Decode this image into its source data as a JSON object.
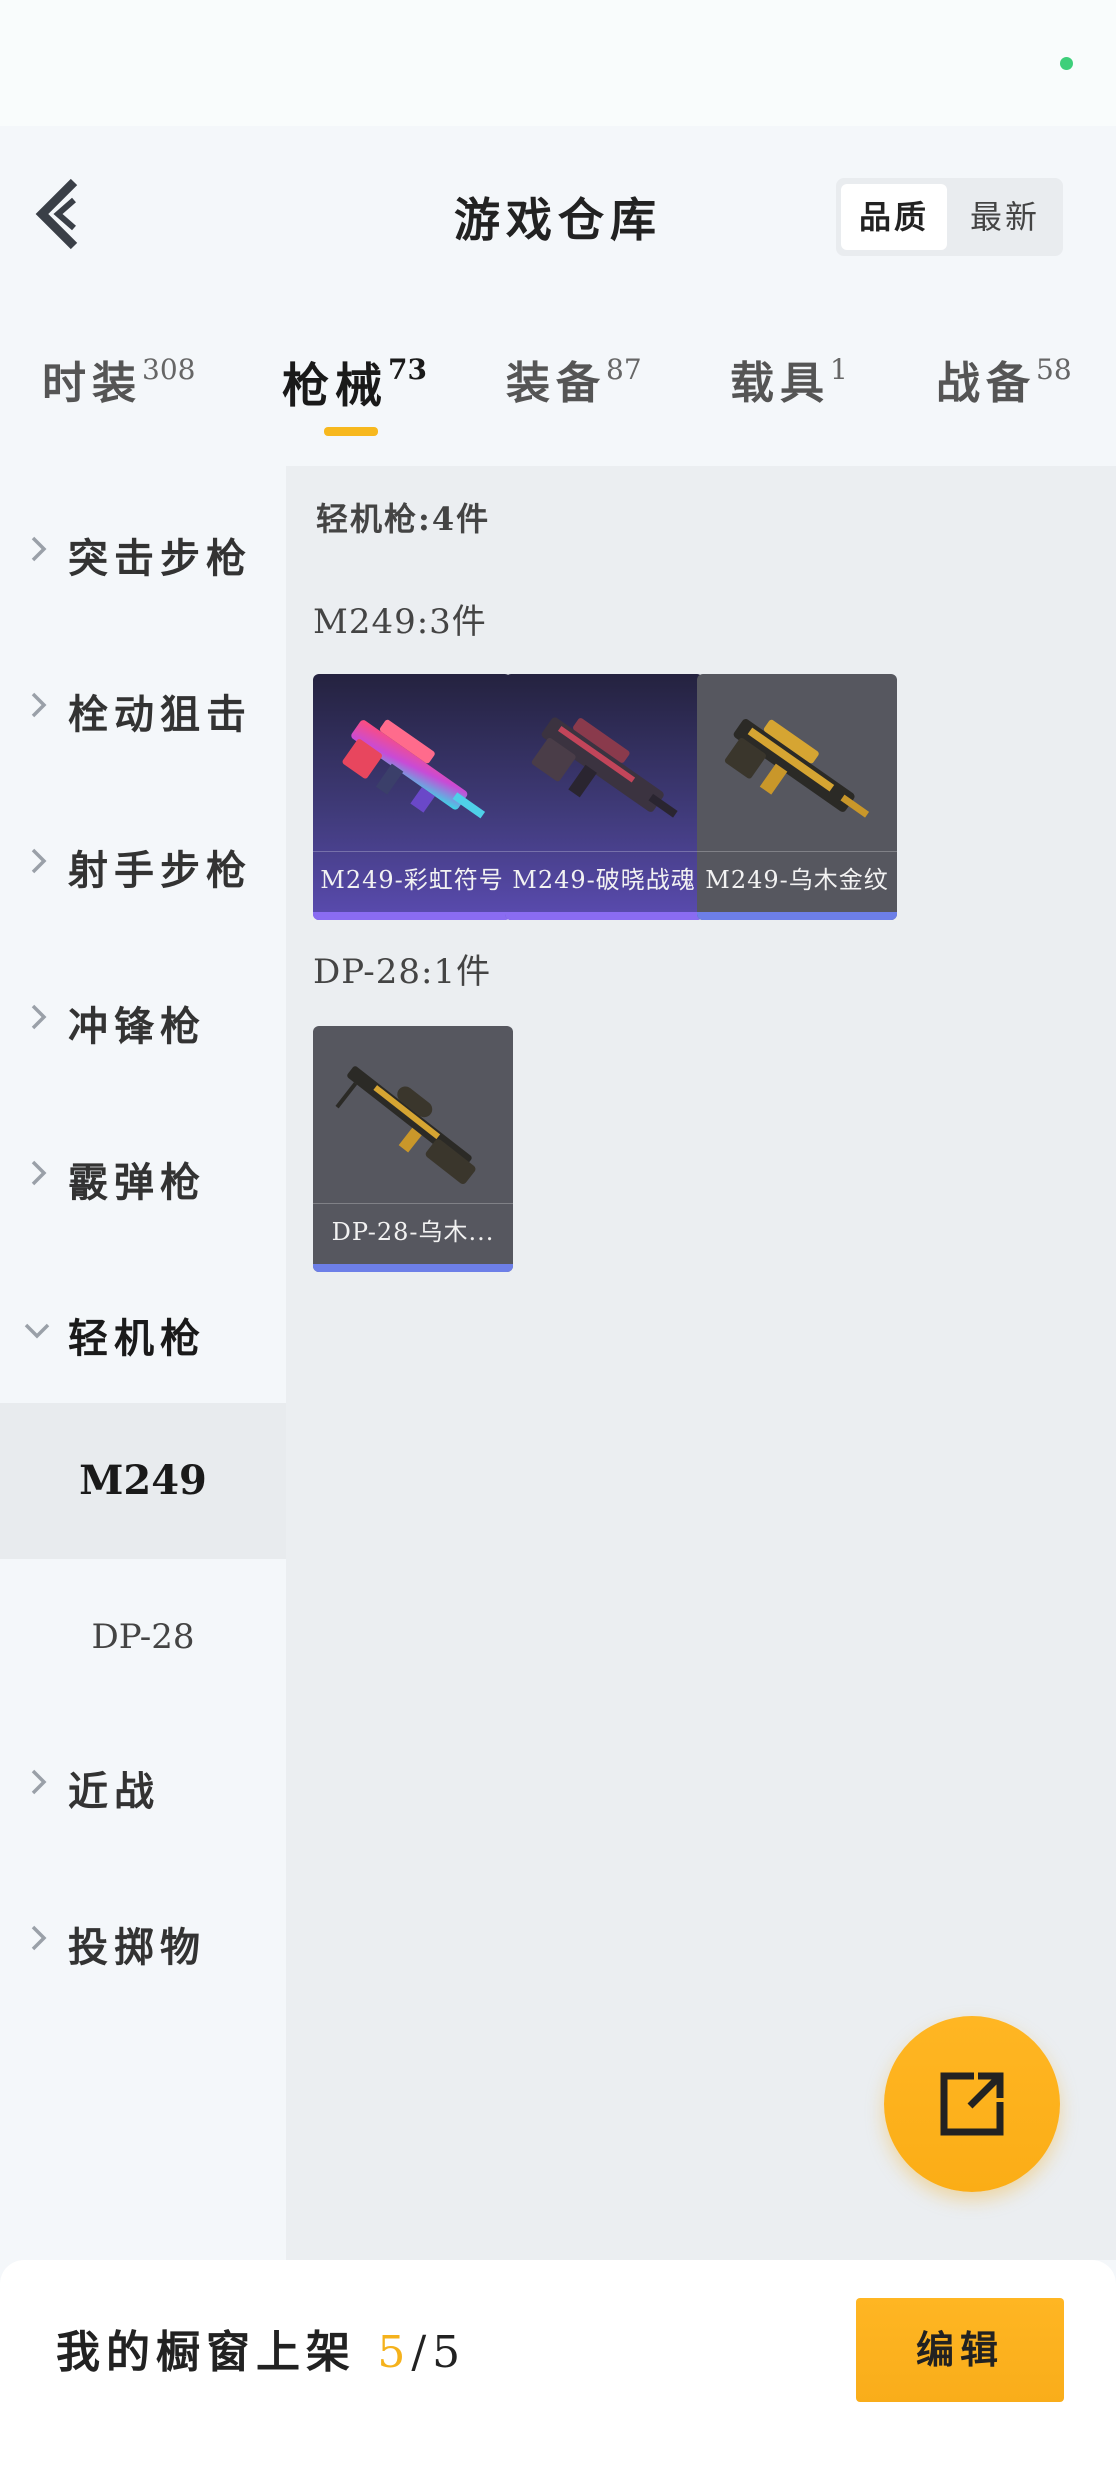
{
  "header": {
    "title": "游戏仓库",
    "sort_options": [
      "品质",
      "最新"
    ]
  },
  "tabs": [
    {
      "label": "时装",
      "count": "308"
    },
    {
      "label": "枪械",
      "count": "73"
    },
    {
      "label": "装备",
      "count": "87"
    },
    {
      "label": "载具",
      "count": "1"
    },
    {
      "label": "战备",
      "count": "58"
    }
  ],
  "sidebar": {
    "items": [
      {
        "label": "突击步枪"
      },
      {
        "label": "栓动狙击"
      },
      {
        "label": "射手步枪"
      },
      {
        "label": "冲锋枪"
      },
      {
        "label": "霰弹枪"
      },
      {
        "label": "轻机枪"
      },
      {
        "label": "近战"
      },
      {
        "label": "投掷物"
      }
    ],
    "subitems": [
      {
        "label": "M249"
      },
      {
        "label": "DP-28"
      }
    ]
  },
  "content": {
    "category_heading": "轻机枪:4件",
    "groups": [
      {
        "heading": "M249:3件",
        "items": [
          {
            "name": "M249-彩虹符号"
          },
          {
            "name": "M249-破晓战魂"
          },
          {
            "name": "M249-乌木金纹"
          }
        ]
      },
      {
        "heading": "DP-28:1件",
        "items": [
          {
            "name": "DP-28-乌木..."
          }
        ]
      }
    ]
  },
  "footer": {
    "label": "我的橱窗上架",
    "count_current": "5",
    "count_total": "/5",
    "edit_label": "编辑"
  },
  "colors": {
    "accent": "#f7b81e",
    "status_dot": "#3ecf7a"
  },
  "icons": [
    "back-arrow-icon",
    "chevron-right-icon",
    "chevron-down-icon",
    "share-external-icon"
  ]
}
